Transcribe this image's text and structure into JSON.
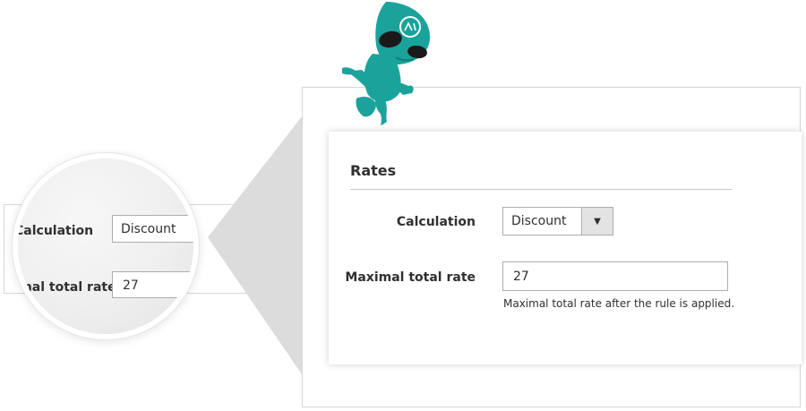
{
  "colors": {
    "mascot": "#1aa39b",
    "mascot_dark": "#0e7f78",
    "border": "#adadad",
    "select_button": "#e3e3e3"
  },
  "background_form": {
    "calculation_label": "Calculation",
    "max_rate_label": "Maximal total rate"
  },
  "magnifier": {
    "calculation_label": "Calculation",
    "calculation_value": "Discount",
    "max_rate_label": "Maximal total rate",
    "max_rate_value": "27"
  },
  "rates": {
    "title": "Rates",
    "calculation_label": "Calculation",
    "calculation_value": "Discount",
    "max_rate_label": "Maximal total rate",
    "max_rate_value": "27",
    "max_rate_note": "Maximal total rate after the rule is applied."
  },
  "icons": {
    "dropdown": "chevron-down-icon",
    "mascot": "alien-mascot-logo"
  }
}
